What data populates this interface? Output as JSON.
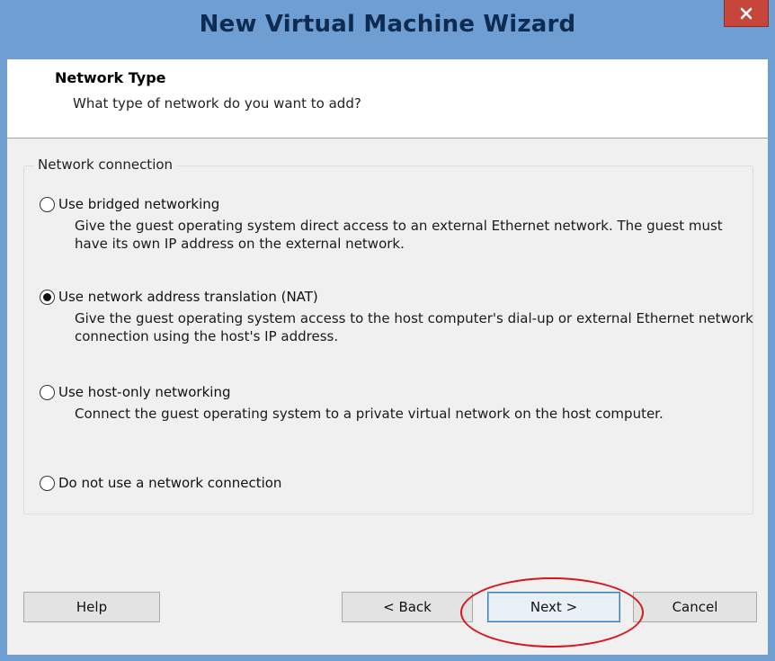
{
  "window": {
    "title": "New Virtual Machine Wizard",
    "close_glyph": "×"
  },
  "header": {
    "title": "Network Type",
    "subtitle": "What type of network do you want to add?"
  },
  "group": {
    "legend": "Network connection",
    "selected": "nat",
    "options": [
      {
        "id": "bridged",
        "label": "Use bridged networking",
        "description": "Give the guest operating system direct access to an external Ethernet network. The guest must have its own IP address on the external network.",
        "checked": false
      },
      {
        "id": "nat",
        "label": "Use network address translation (NAT)",
        "description": "Give the guest operating system access to the host computer's dial-up or external Ethernet network connection using the host's IP address.",
        "checked": true
      },
      {
        "id": "hostonly",
        "label": "Use host-only networking",
        "description": "Connect the guest operating system to a private virtual network on the host computer.",
        "checked": false
      },
      {
        "id": "none",
        "label": "Do not use a network connection",
        "description": "",
        "checked": false
      }
    ]
  },
  "buttons": {
    "help": "Help",
    "back": "< Back",
    "next": "Next >",
    "cancel": "Cancel"
  },
  "colors": {
    "titlebar": "#6f9ed2",
    "close_button": "#c7463b",
    "annotation_ring": "#d9141b"
  }
}
